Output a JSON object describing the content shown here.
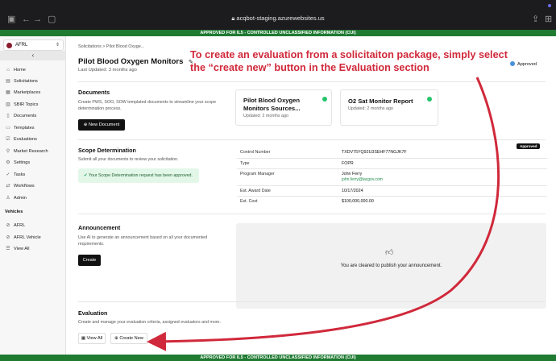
{
  "browser": {
    "url": "acqbot-staging.azurewebsites.us"
  },
  "banners": {
    "top": "APPROVED FOR IL5 - CONTROLLED UNCLASSIFIED INFORMATION (CUI)",
    "bottom": "APPROVED FOR IL5 - CONTROLLED UNCLASSIFIED INFORMATION (CUI)"
  },
  "sidebar": {
    "org": "AFRL",
    "nav": [
      "Home",
      "Solicitations",
      "Marketplaces",
      "SBIR Topics",
      "Documents",
      "Templates",
      "Evaluations",
      "Market Research",
      "Settings",
      "Tasks",
      "Workflows",
      "Admin"
    ],
    "vehicles_heading": "Vehicles",
    "vehicles": [
      "AFRL",
      "AFRL Vehicle",
      "View All"
    ]
  },
  "header": {
    "breadcrumb_root": "Solicitations",
    "breadcrumb_sep": ">",
    "breadcrumb_current": "Pilot Blood Oxyge...",
    "title": "Pilot Blood Oxygen Monitors",
    "updated": "Last Updated: 3 months ago",
    "status": "Approved",
    "status_color": "#4a90d9"
  },
  "documents": {
    "heading": "Documents",
    "description": "Create PWS, SOO, SOW templated documents to streamline your scope determination process.",
    "button": "New Document",
    "cards": [
      {
        "title": "Pilot Blood Oxygen Monitors Sources...",
        "updated": "Updated: 2 months ago"
      },
      {
        "title": "O2 Sat Monitor Report",
        "updated": "Updated: 2 months ago"
      }
    ]
  },
  "scope": {
    "heading": "Scope Determination",
    "description": "Submit all your documents to review your solicitation.",
    "alert": "Your Scope Determination request has been approved.",
    "badge": "Approved",
    "rows": [
      {
        "key": "Control Number",
        "value": "TXDV75YQ92U3SEHF77NGJK7F"
      },
      {
        "key": "Type",
        "value": "FOPR"
      },
      {
        "key": "Program Manager",
        "value": "John Ferry",
        "extra": "john.ferry@lacgov.com"
      },
      {
        "key": "Est. Award Date",
        "value": "10/17/2024"
      },
      {
        "key": "Est. Cost",
        "value": "$100,000,000.00"
      }
    ]
  },
  "announcement": {
    "heading": "Announcement",
    "description": "Use AI to generate an announcement based on all your documented requirements.",
    "button": "Create",
    "panel_text": "You are cleared to publish your announcement."
  },
  "evaluation": {
    "heading": "Evaluation",
    "description": "Create and manage your evaluation criteria, assigned evaluators and more.",
    "view_all": "View All",
    "create_new": "Create New"
  },
  "annotation": {
    "text": "To create an evaluation from a solicitaiton package, simply select the “create new” button in the Evaluation section",
    "color": "#d0293b"
  }
}
